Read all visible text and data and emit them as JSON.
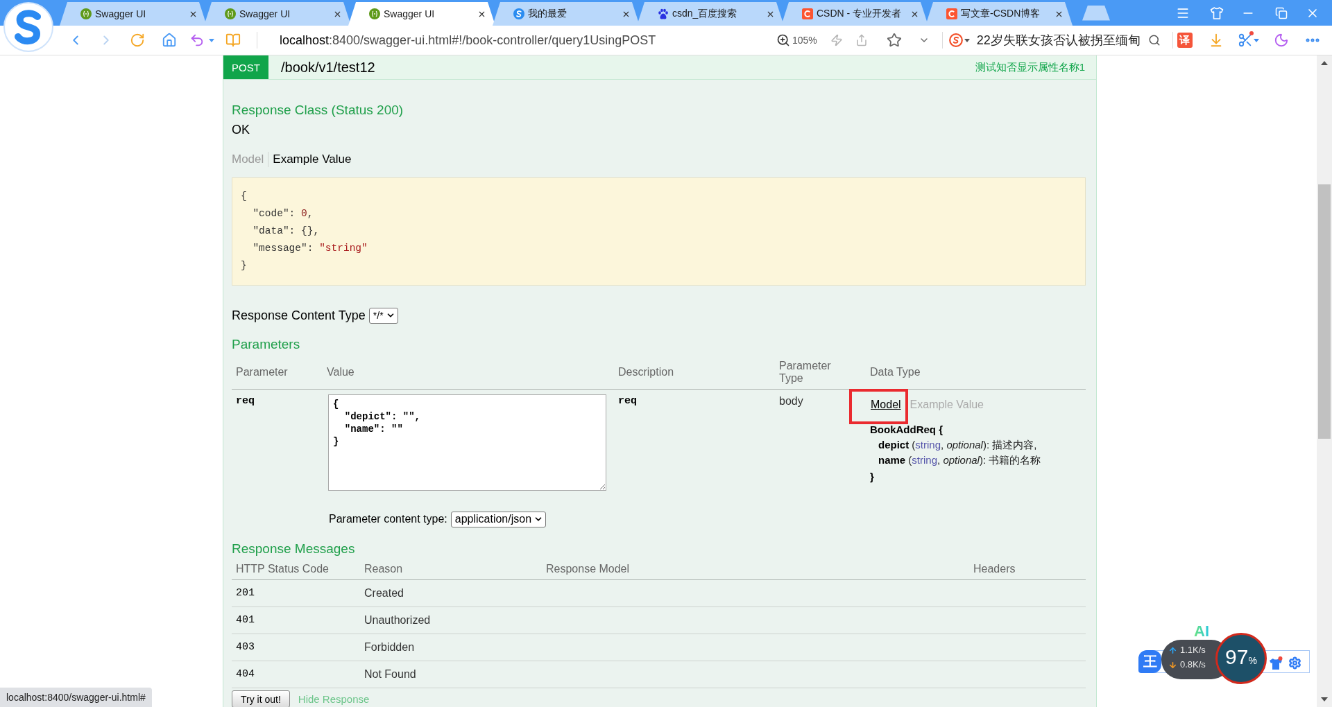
{
  "browser": {
    "tabs": [
      {
        "title": "Swagger UI",
        "kind": "braces",
        "selected": false
      },
      {
        "title": "Swagger UI",
        "kind": "braces",
        "selected": false
      },
      {
        "title": "Swagger UI",
        "kind": "braces",
        "selected": true
      },
      {
        "title": "我的最爱",
        "kind": "swirl",
        "selected": false
      },
      {
        "title": "csdn_百度搜索",
        "kind": "paw",
        "selected": false
      },
      {
        "title": "CSDN - 专业开发者",
        "kind": "arc",
        "selected": false
      },
      {
        "title": "写文章-CSDN博客",
        "kind": "arc",
        "selected": false
      }
    ],
    "address": {
      "host": "localhost",
      "rest": ":8400/swagger-ui.html#!/book-controller/query1UsingPOST"
    },
    "zoom": "105%",
    "search": {
      "placeholder": "22岁失联女孩否认被拐至缅甸"
    },
    "translate": "译"
  },
  "operation": {
    "method": "POST",
    "path": "/book/v1/test12",
    "summary": "测试知否显示属性名称1"
  },
  "response_class": {
    "heading": "Response Class (Status 200)",
    "status": "OK",
    "tabs": [
      {
        "label": "Model",
        "selected": false
      },
      {
        "label": "Example Value",
        "selected": true
      }
    ],
    "example": [
      [
        {
          "text": "{",
          "kind": "plain"
        }
      ],
      [
        {
          "text": "  \"code\": ",
          "kind": "plain"
        },
        {
          "text": "0",
          "kind": "number"
        },
        {
          "text": ",",
          "kind": "plain"
        }
      ],
      [
        {
          "text": "  \"data\": {},",
          "kind": "plain"
        }
      ],
      [
        {
          "text": "  \"message\": ",
          "kind": "plain"
        },
        {
          "text": "\"string\"",
          "kind": "string"
        }
      ],
      [
        {
          "text": "}",
          "kind": "plain"
        }
      ]
    ]
  },
  "response_content_type": {
    "label": "Response Content Type",
    "value": "*/*"
  },
  "parameters": {
    "heading": "Parameters",
    "columns": [
      "Parameter",
      "Value",
      "Description",
      "Parameter Type",
      "Data Type"
    ],
    "rows": [
      {
        "name": "req",
        "value": "{\n  \"depict\": \"\",\n  \"name\": \"\"\n}",
        "description": "req",
        "type": "body",
        "data_type_tabs": [
          {
            "label": "Model",
            "selected": true,
            "highlighted": true
          },
          {
            "label": "Example Value",
            "selected": false,
            "highlighted": false
          }
        ],
        "model": [
          {
            "kind": "open",
            "tokens": [
              {
                "text": "BookAddReq {",
                "kind": "name"
              }
            ]
          },
          {
            "kind": "property",
            "tokens": [
              {
                "text": "depict",
                "kind": "name"
              },
              {
                "text": " (",
                "kind": "plain"
              },
              {
                "text": "string",
                "kind": "type"
              },
              {
                "text": ", ",
                "kind": "plain"
              },
              {
                "text": "optional",
                "kind": "flag"
              },
              {
                "text": "): 描述内容,",
                "kind": "plain"
              }
            ]
          },
          {
            "kind": "property",
            "tokens": [
              {
                "text": "name",
                "kind": "name"
              },
              {
                "text": " (",
                "kind": "plain"
              },
              {
                "text": "string",
                "kind": "type"
              },
              {
                "text": ", ",
                "kind": "plain"
              },
              {
                "text": "optional",
                "kind": "flag"
              },
              {
                "text": "): 书籍的名称",
                "kind": "plain"
              }
            ]
          },
          {
            "kind": "close",
            "tokens": [
              {
                "text": "}",
                "kind": "name"
              }
            ]
          }
        ]
      }
    ],
    "content_type": {
      "label": "Parameter content type:",
      "value": "application/json"
    }
  },
  "response_messages": {
    "heading": "Response Messages",
    "columns": [
      "HTTP Status Code",
      "Reason",
      "Response Model",
      "Headers"
    ],
    "rows": [
      {
        "code": "201",
        "reason": "Created"
      },
      {
        "code": "401",
        "reason": "Unauthorized"
      },
      {
        "code": "403",
        "reason": "Forbidden"
      },
      {
        "code": "404",
        "reason": "Not Found"
      }
    ]
  },
  "actions": {
    "try": "Try it out!",
    "hide": "Hide Response"
  },
  "status_tooltip": "localhost:8400/swagger-ui.html#",
  "speed_widget": {
    "badge": "王",
    "ai": "AI",
    "upload": "1.1K/s",
    "download": "0.8K/s",
    "load": "97",
    "unit": "%"
  }
}
